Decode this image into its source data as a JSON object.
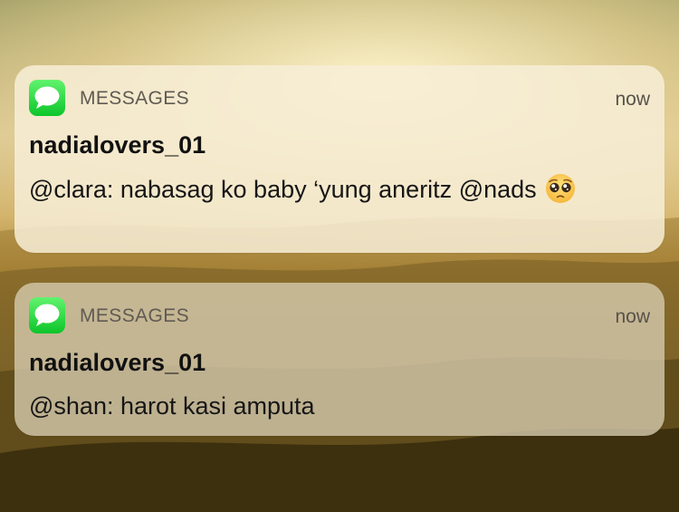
{
  "notifications": [
    {
      "app_icon": "messages-bubble-icon",
      "app_name": "MESSAGES",
      "time": "now",
      "sender": "nadialovers_01",
      "message": "@clara: nabasag ko baby ‘yung aneritz @nads",
      "emoji": "pleading-face-icon"
    },
    {
      "app_icon": "messages-bubble-icon",
      "app_name": "MESSAGES",
      "time": "now",
      "sender": "nadialovers_01",
      "message": "@shan: harot kasi amputa"
    }
  ],
  "colors": {
    "messages_green": "#0cc52a",
    "card_light": "#f7eed6",
    "card_dim": "#d6caae",
    "sky_glow": "#fff6cd"
  }
}
